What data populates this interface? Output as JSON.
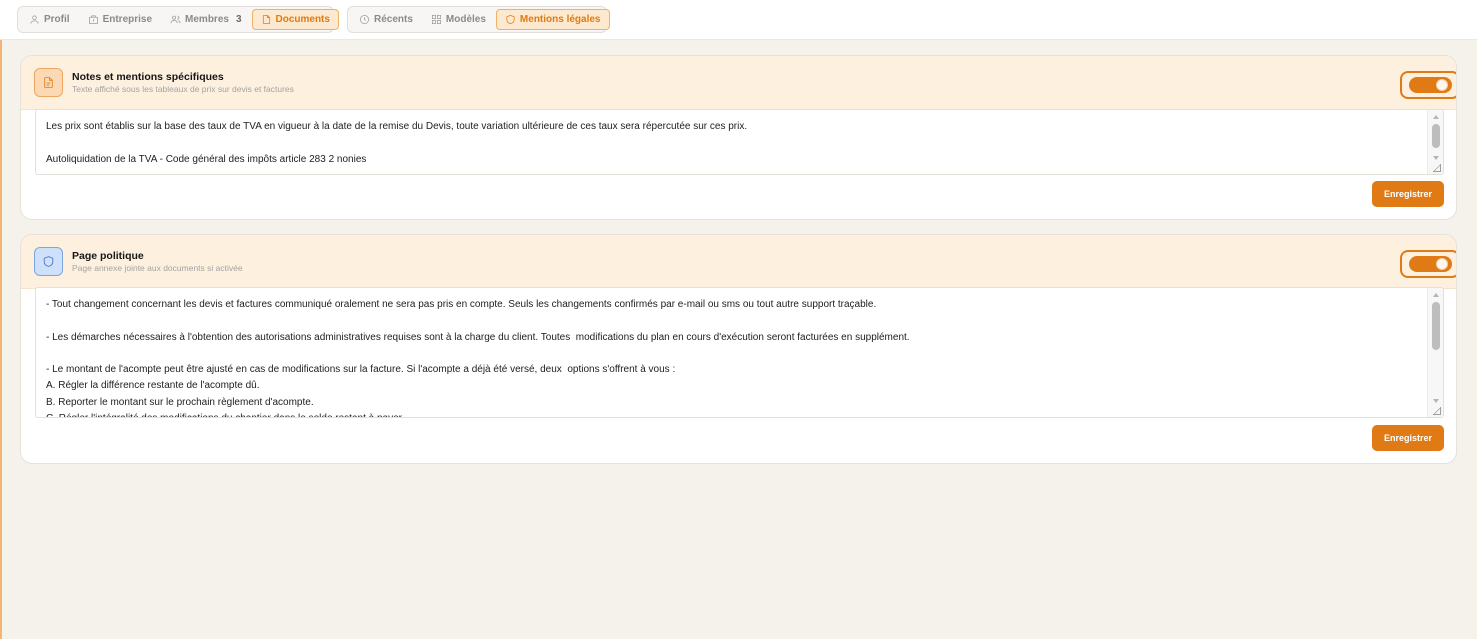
{
  "tabs_group1": [
    {
      "label": "Profil",
      "icon": "user-icon",
      "active": false
    },
    {
      "label": "Entreprise",
      "icon": "building-icon",
      "active": false
    },
    {
      "label": "Membres",
      "icon": "users-icon",
      "count": "3",
      "active": false
    },
    {
      "label": "Documents",
      "icon": "file-icon",
      "active": true
    }
  ],
  "tabs_group2": [
    {
      "label": "Récents",
      "icon": "clock-icon",
      "active": false
    },
    {
      "label": "Modèles",
      "icon": "grid-icon",
      "active": false
    },
    {
      "label": "Mentions légales",
      "icon": "shield-icon",
      "active": true
    }
  ],
  "notes_card": {
    "title": "Notes et mentions spécifiques",
    "subtitle": "Texte affiché sous les tableaux de prix sur devis et factures",
    "toggle_on": true,
    "text": "Les prix sont établis sur la base des taux de TVA en vigueur à la date de la remise du Devis, toute variation ultérieure de ces taux sera répercutée sur ces prix.\n\nAutoliquidation de la TVA - Code général des impôts article 283 2 nonies",
    "save_label": "Enregistrer"
  },
  "policy_card": {
    "title": "Page politique",
    "subtitle": "Page annexe jointe aux documents si activée",
    "toggle_on": true,
    "text": "- Tout changement concernant les devis et factures communiqué oralement ne sera pas pris en compte. Seuls les changements confirmés par e-mail ou sms ou tout autre support traçable.\n\n- Les démarches nécessaires à l'obtention des autorisations administratives requises sont à la charge du client. Toutes  modifications du plan en cours d'exécution seront facturées en supplément.\n\n- Le montant de l'acompte peut être ajusté en cas de modifications sur la facture. Si l'acompte a déjà été versé, deux  options s'offrent à vous :\nA. Régler la différence restante de l'acompte dû.\nB. Reporter le montant sur le prochain règlement d'acompte.\nC. Régler l'intégralité des modifications du chantier dans le solde restant à payer.",
    "save_label": "Enregistrer"
  },
  "colors": {
    "accent": "#e07a14",
    "header_bg": "#fdf0de",
    "page_bg": "#f5f2ec"
  }
}
